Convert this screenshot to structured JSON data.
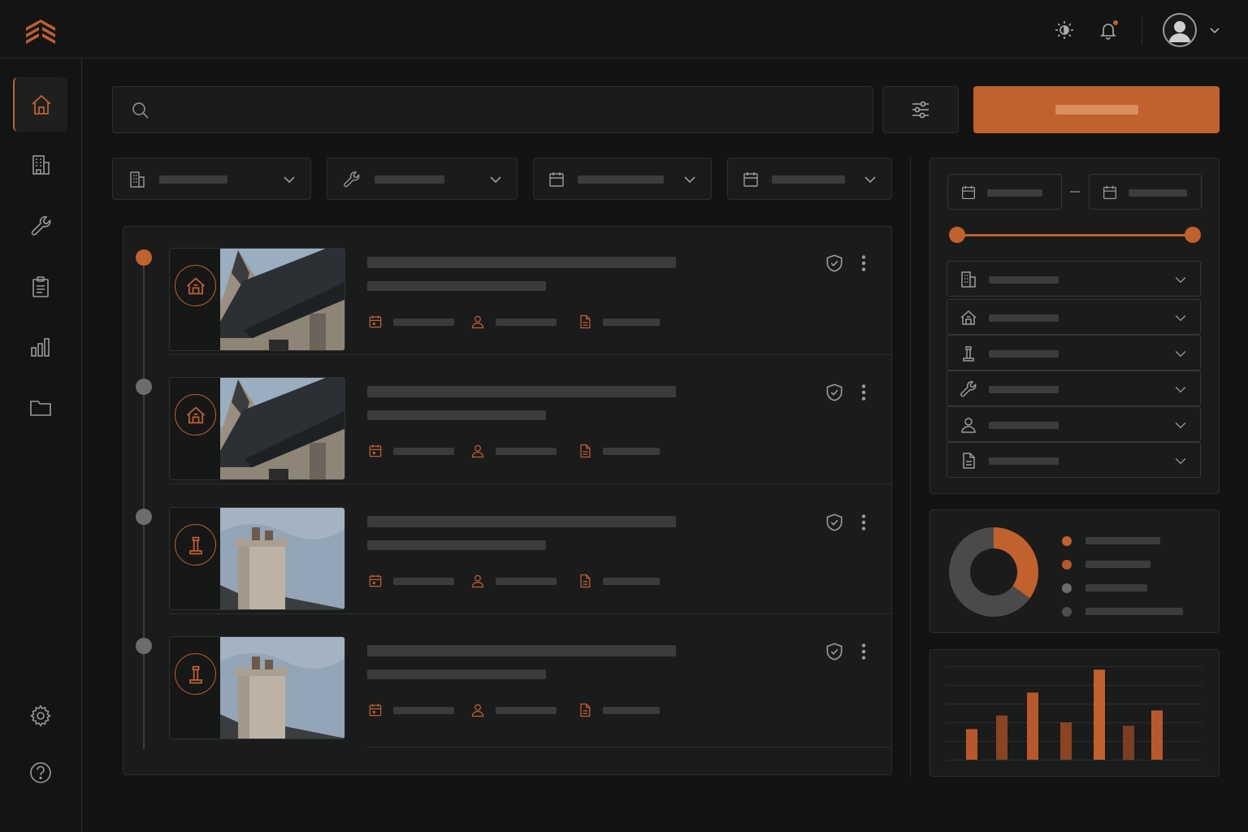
{
  "colors": {
    "accent": "#c0612e",
    "accent_dark": "#7a3f20",
    "muted": "#6c6c6c",
    "dark_slice": "#4a4a4a"
  },
  "icons": {
    "logo": "stacked-roof-logo",
    "top": [
      "sun-moon-icon",
      "bell-icon",
      "user-avatar-icon",
      "chevron-down-icon"
    ],
    "sidebar": [
      "home-icon",
      "building-icon",
      "wrench-icon",
      "clipboard-icon",
      "bar-chart-icon",
      "folder-icon",
      "gear-icon",
      "help-icon"
    ],
    "filters": [
      "building-icon",
      "wrench-icon",
      "calendar-icon",
      "calendar-icon"
    ],
    "accordion": [
      "building-icon",
      "house-icon",
      "chimney-icon",
      "wrench-icon",
      "user-icon",
      "document-icon"
    ]
  },
  "list": {
    "items": [
      {
        "icon": "house-icon",
        "photo": "roof-photo",
        "active": true
      },
      {
        "icon": "house-icon",
        "photo": "roof-photo",
        "active": false
      },
      {
        "icon": "chimney-icon",
        "photo": "chimney-photo",
        "active": false
      },
      {
        "icon": "chimney-icon",
        "photo": "chimney-photo",
        "active": false
      }
    ]
  },
  "range": {
    "start": 0,
    "end": 1
  },
  "chart_data": [
    {
      "type": "pie",
      "values": [
        35,
        65
      ],
      "colors": [
        "#c0612e",
        "#4a4a4a"
      ],
      "donut": true,
      "legend_position": "right"
    },
    {
      "type": "bar",
      "values": [
        36,
        52,
        79,
        44,
        106,
        40,
        58
      ],
      "colors": [
        "#b8582a",
        "#8a4422",
        "#b8582a",
        "#8a4422",
        "#c0612e",
        "#7a3f20",
        "#b8582a"
      ],
      "grid": true
    }
  ]
}
